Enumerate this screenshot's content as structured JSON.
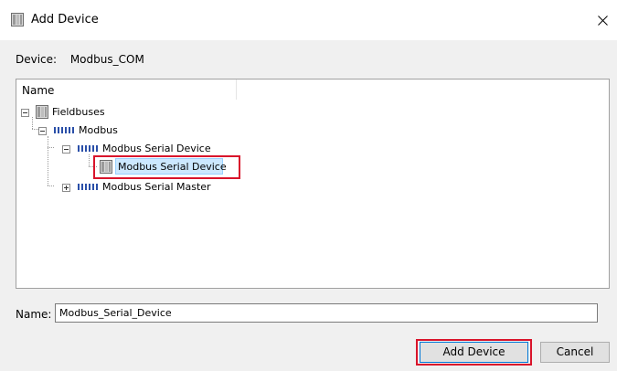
{
  "window": {
    "title": "Add Device",
    "close_icon": "close-icon"
  },
  "device": {
    "label": "Device:",
    "value": "Modbus_COM"
  },
  "tree": {
    "column_header": "Name",
    "nodes": [
      {
        "label": "Fieldbuses",
        "icon": "device-folder-icon",
        "expanded": true
      },
      {
        "label": "Modbus",
        "icon": "bus-icon",
        "expanded": true
      },
      {
        "label": "Modbus Serial Device",
        "icon": "bus-icon",
        "expanded": true
      },
      {
        "label": "Modbus Serial Device",
        "icon": "device-icon",
        "selected": true,
        "highlighted": true
      },
      {
        "label": "Modbus Serial Master",
        "icon": "bus-icon",
        "expanded": false
      }
    ]
  },
  "name_field": {
    "label": "Name:",
    "value": "Modbus_Serial_Device"
  },
  "buttons": {
    "add": "Add Device",
    "cancel": "Cancel"
  },
  "colors": {
    "highlight": "#d9142b",
    "selection": "#cce8ff",
    "bus_icon": "#2a4fa8"
  }
}
